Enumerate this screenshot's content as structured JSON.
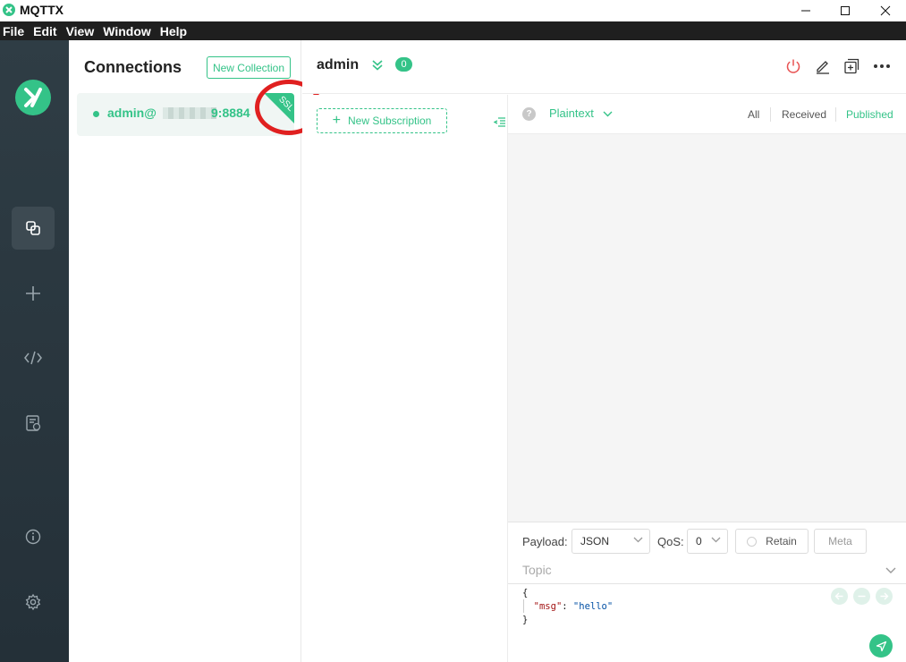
{
  "window": {
    "title": "MQTTX"
  },
  "menu": [
    "File",
    "Edit",
    "View",
    "Window",
    "Help"
  ],
  "connections": {
    "heading": "Connections",
    "new_collection": "New Collection",
    "items": [
      {
        "name_prefix": "admin@",
        "name_suffix": "9:8884",
        "badge": "SSL",
        "status": "connected"
      }
    ]
  },
  "header": {
    "title": "admin",
    "sub_count": "0"
  },
  "subscriptions": {
    "new_label": "New Subscription"
  },
  "messages": {
    "format": "Plaintext",
    "filters": [
      "All",
      "Received",
      "Published"
    ],
    "active_filter": "Published"
  },
  "publish": {
    "payload_label": "Payload:",
    "payload_format": "JSON",
    "qos_label": "QoS:",
    "qos_value": "0",
    "retain_label": "Retain",
    "meta_label": "Meta",
    "topic_placeholder": "Topic",
    "payload_lines": [
      "{",
      "  \"msg\": \"hello\"",
      "}"
    ],
    "payload_key": "\"msg\"",
    "payload_value": "\"hello\""
  },
  "colors": {
    "accent": "#34c388",
    "nav_bg": "#2f3d45",
    "disconnect": "#e85353",
    "annotation": "#e02020"
  }
}
